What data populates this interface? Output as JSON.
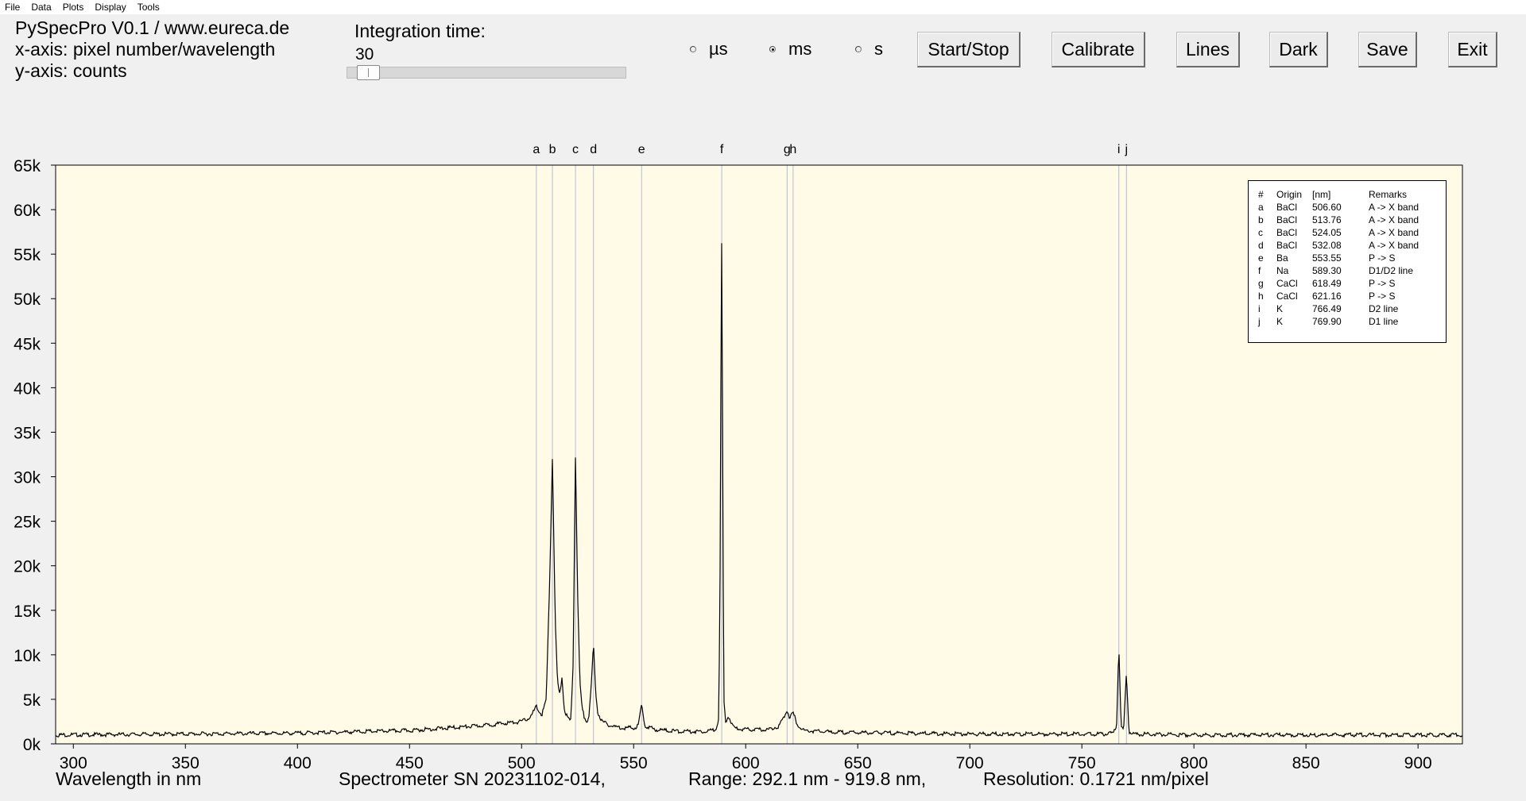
{
  "menu": [
    "File",
    "Data",
    "Plots",
    "Display",
    "Tools"
  ],
  "info": {
    "title": "PySpecPro V0.1 / www.eureca.de",
    "xaxis": "x-axis: pixel number/wavelength",
    "yaxis": "y-axis: counts"
  },
  "integration": {
    "label": "Integration time:",
    "value": "30",
    "slider_fraction": 0.035
  },
  "units": [
    {
      "label": "µs",
      "checked": false
    },
    {
      "label": "ms",
      "checked": true
    },
    {
      "label": "s",
      "checked": false
    }
  ],
  "buttons": {
    "start_stop": "Start/Stop",
    "calibrate": "Calibrate",
    "lines": "Lines",
    "dark": "Dark",
    "save": "Save",
    "exit": "Exit"
  },
  "footer": {
    "xlabel": "Wavelength in nm",
    "spectrometer": "Spectrometer SN 20231102-014,",
    "range": "Range: 292.1 nm - 919.8 nm,",
    "resolution": "Resolution: 0.1721 nm/pixel"
  },
  "colors": {
    "plot_bg": "#fffbe6",
    "marker_line": "#b4b9d6",
    "trace": "#000000"
  },
  "legend": {
    "headers": [
      "#",
      "Origin",
      "[nm]",
      "Remarks"
    ],
    "rows": [
      [
        "a",
        "BaCl",
        "506.60",
        "A -> X band"
      ],
      [
        "b",
        "BaCl",
        "513.76",
        "A -> X band"
      ],
      [
        "c",
        "BaCl",
        "524.05",
        "A -> X band"
      ],
      [
        "d",
        "BaCl",
        "532.08",
        "A -> X band"
      ],
      [
        "e",
        "Ba",
        "553.55",
        "P -> S"
      ],
      [
        "f",
        "Na",
        "589.30",
        "D1/D2 line"
      ],
      [
        "g",
        "CaCl",
        "618.49",
        "P -> S"
      ],
      [
        "h",
        "CaCl",
        "621.16",
        "P -> S"
      ],
      [
        "i",
        "K",
        "766.49",
        "D2 line"
      ],
      [
        "j",
        "K",
        "769.90",
        "D1 line"
      ]
    ]
  },
  "chart_data": {
    "type": "line",
    "xlim": [
      292.1,
      919.8
    ],
    "ylim": [
      0,
      65000
    ],
    "xticks": [
      300,
      350,
      400,
      450,
      500,
      550,
      600,
      650,
      700,
      750,
      800,
      850,
      900
    ],
    "yticks": [
      {
        "value": 0,
        "label": "0k"
      },
      {
        "value": 5000,
        "label": "5k"
      },
      {
        "value": 10000,
        "label": "10k"
      },
      {
        "value": 15000,
        "label": "15k"
      },
      {
        "value": 20000,
        "label": "20k"
      },
      {
        "value": 25000,
        "label": "25k"
      },
      {
        "value": 30000,
        "label": "30k"
      },
      {
        "value": 35000,
        "label": "35k"
      },
      {
        "value": 40000,
        "label": "40k"
      },
      {
        "value": 45000,
        "label": "45k"
      },
      {
        "value": 50000,
        "label": "50k"
      },
      {
        "value": 55000,
        "label": "55k"
      },
      {
        "value": 60000,
        "label": "60k"
      },
      {
        "value": 65000,
        "label": "65k"
      }
    ],
    "grid": false,
    "markers": [
      {
        "label": "a",
        "x": 506.6
      },
      {
        "label": "b",
        "x": 513.76
      },
      {
        "label": "c",
        "x": 524.05
      },
      {
        "label": "d",
        "x": 532.08
      },
      {
        "label": "e",
        "x": 553.55
      },
      {
        "label": "f",
        "x": 589.3
      },
      {
        "label": "g",
        "x": 618.49
      },
      {
        "label": "h",
        "x": 621.16
      },
      {
        "label": "i",
        "x": 766.49
      },
      {
        "label": "j",
        "x": 769.9
      }
    ],
    "series": [
      {
        "x": [
          292.1,
          400,
          450,
          480,
          500,
          504,
          506.6,
          509,
          511,
          512.5,
          513.76,
          515,
          516,
          517,
          518,
          519,
          520,
          521,
          522,
          523,
          524.05,
          525,
          526,
          527,
          528,
          529,
          530,
          531,
          532.08,
          533,
          534,
          536,
          540,
          545,
          550,
          552,
          553.55,
          555,
          560,
          570,
          580,
          585,
          587,
          588,
          588.6,
          589.0,
          589.3,
          589.7,
          590.2,
          591,
          592,
          593,
          594,
          596,
          600,
          610,
          615,
          617,
          618.49,
          619.5,
          621.16,
          623,
          626,
          640,
          700,
          760,
          764,
          765.5,
          766.49,
          767.5,
          768.6,
          769.9,
          771,
          773,
          800,
          919.8
        ],
        "y": [
          1000,
          1200,
          1500,
          2000,
          2500,
          3000,
          4200,
          3200,
          5000,
          18000,
          32200,
          14000,
          7000,
          5500,
          7500,
          4000,
          3200,
          2800,
          2600,
          9000,
          32800,
          17000,
          7000,
          4000,
          3000,
          2500,
          3000,
          6000,
          11300,
          6000,
          3500,
          2500,
          2000,
          1800,
          1800,
          2000,
          4400,
          2000,
          1600,
          1400,
          1400,
          1500,
          1800,
          3000,
          20000,
          45000,
          56700,
          35000,
          5000,
          2500,
          3000,
          2800,
          2000,
          1700,
          1600,
          1600,
          2000,
          3000,
          3800,
          3000,
          3500,
          2200,
          1500,
          1300,
          1100,
          1100,
          1200,
          2000,
          11200,
          2000,
          1400,
          8000,
          1400,
          1100,
          1000,
          1000
        ]
      }
    ]
  }
}
